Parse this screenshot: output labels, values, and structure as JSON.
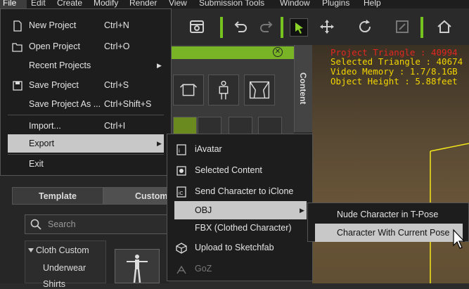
{
  "menubar": {
    "items": [
      "File",
      "Edit",
      "Create",
      "Modify",
      "Render",
      "View",
      "Submission Tools",
      "Window",
      "Plugins",
      "Help"
    ]
  },
  "file_menu": {
    "items": [
      {
        "label": "New Project",
        "shortcut": "Ctrl+N",
        "icon": "new-file-icon"
      },
      {
        "label": "Open Project",
        "shortcut": "Ctrl+O",
        "icon": "folder-open-icon"
      },
      {
        "label": "Recent Projects",
        "shortcut": "",
        "icon": ""
      },
      {
        "label": "Save Project",
        "shortcut": "Ctrl+S",
        "icon": "floppy-disk-icon"
      },
      {
        "label": "Save Project As ...",
        "shortcut": "Ctrl+Shift+S",
        "icon": ""
      },
      {
        "label": "Import...",
        "shortcut": "Ctrl+I",
        "icon": ""
      },
      {
        "label": "Export",
        "shortcut": "",
        "icon": ""
      },
      {
        "label": "Exit",
        "shortcut": "",
        "icon": ""
      }
    ]
  },
  "export_menu": {
    "items": [
      {
        "label": "iAvatar",
        "icon": "iavatar-icon"
      },
      {
        "label": "Selected Content",
        "icon": "selected-content-icon"
      },
      {
        "label": "Send Character to iClone",
        "icon": "iclone-icon"
      },
      {
        "label": "OBJ",
        "icon": ""
      },
      {
        "label": "FBX (Clothed Character)",
        "icon": ""
      },
      {
        "label": "Upload to Sketchfab",
        "icon": "sketchfab-icon"
      },
      {
        "label": "GoZ",
        "icon": "goz-icon"
      }
    ]
  },
  "obj_menu": {
    "items": [
      {
        "label": "Nude Character in T-Pose"
      },
      {
        "label": "Character With Current Pose"
      }
    ]
  },
  "content_panel": {
    "tab_label": "Content"
  },
  "viewport_stats": [
    "Project Triangle : 40994",
    "Selected Triangle : 40674",
    "Video Memory : 1.7/8.1GB",
    "Object Height : 5.88feet"
  ],
  "library": {
    "tab_template": "Template",
    "tab_custom": "Custom",
    "search_placeholder": "Search",
    "tree": [
      "Cloth Custom",
      "Underwear",
      "Shirts"
    ]
  },
  "colors": {
    "accent": "#78b426",
    "stat_text": "#f3d500",
    "stat_highlight": "#e02820",
    "menu_selected": "#c8c8c8"
  }
}
